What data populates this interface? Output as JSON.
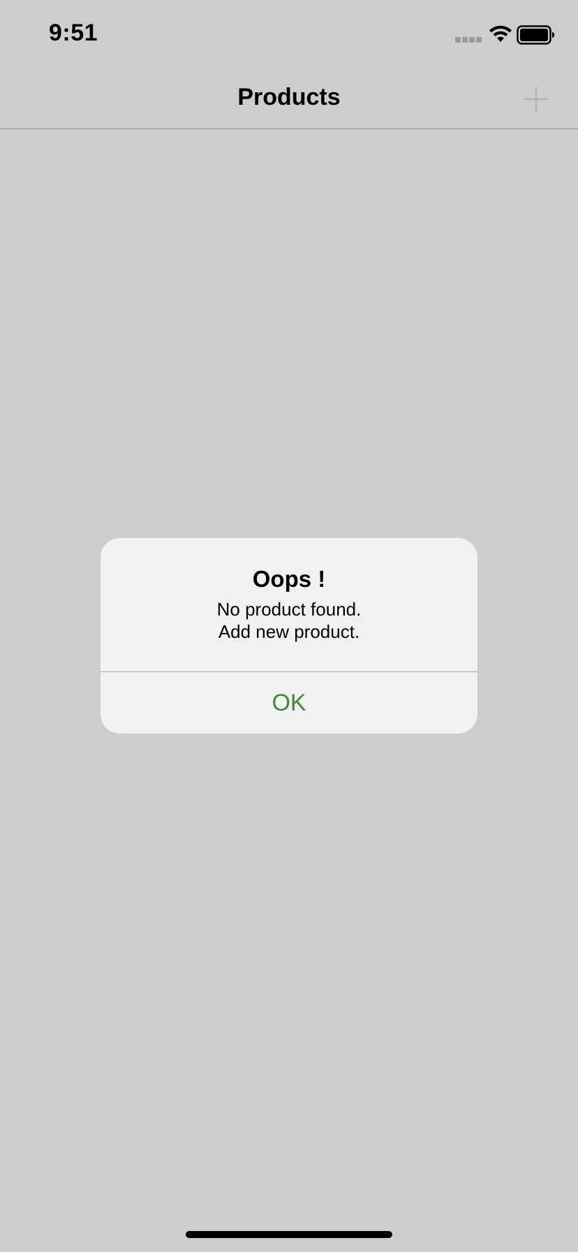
{
  "status_bar": {
    "time": "9:51"
  },
  "nav": {
    "title": "Products",
    "add_icon": "plus-icon"
  },
  "alert": {
    "title": "Oops !",
    "message_line_1": "No product found.",
    "message_line_2": "Add new product.",
    "ok_label": "OK"
  },
  "colors": {
    "background": "#cdcdcd",
    "alert_background": "#f1f1f1",
    "accent": "#3f8a3b",
    "disabled_icon": "#b3b3b3"
  }
}
